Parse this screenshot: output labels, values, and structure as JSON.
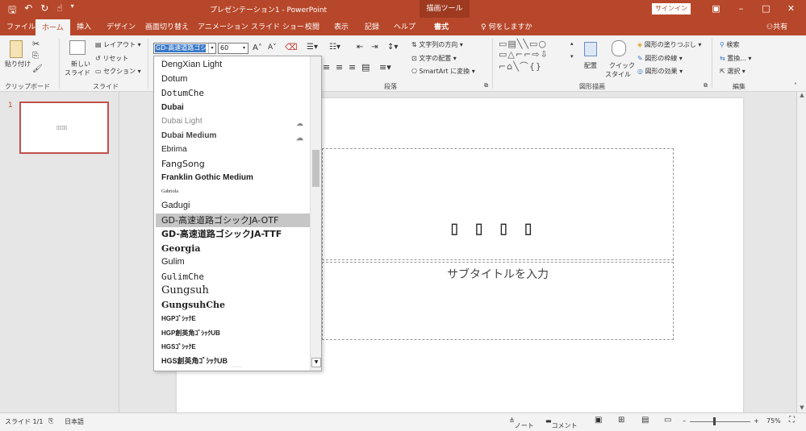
{
  "app": {
    "title": "プレゼンテーション1 - PowerPoint",
    "context_tool": "描画ツール",
    "signin": "サインイン",
    "quick_access": [
      "save-icon",
      "undo-icon",
      "redo-icon",
      "touch-icon",
      "customize-icon"
    ]
  },
  "tabs": [
    "ファイル",
    "ホーム",
    "挿入",
    "デザイン",
    "画面切り替え",
    "アニメーション",
    "スライド ショー",
    "校閲",
    "表示",
    "記録",
    "ヘルプ",
    "書式"
  ],
  "active_tab": "ホーム",
  "tell_me": "何をしますか",
  "share": "共有",
  "ribbon": {
    "clipboard": {
      "paste": "貼り付け",
      "label": "クリップボード"
    },
    "slides": {
      "new_slide_1": "新しい",
      "new_slide_2": "スライド",
      "layout": "レイアウト",
      "reset": "リセット",
      "section": "セクション",
      "label": "スライド"
    },
    "font": {
      "name_value": "GD-高速道路ゴシ",
      "size_value": "60"
    },
    "paragraph": {
      "text_direction": "文字列の方向",
      "align_text": "文字の配置",
      "smartart": "SmartArt に変換",
      "label": "段落"
    },
    "drawing": {
      "arrange": "配置",
      "quick_styles_1": "クイック",
      "quick_styles_2": "スタイル",
      "shape_fill": "図形の塗りつぶし",
      "shape_outline": "図形の枠線",
      "shape_effects": "図形の効果",
      "label": "図形描画"
    },
    "editing": {
      "find": "検索",
      "replace": "置換...",
      "select": "選択",
      "label": "編集"
    }
  },
  "thumbnail": {
    "number": "1",
    "preview": "▯▯▯▯"
  },
  "slide": {
    "title_text": "▯▯▯▯",
    "subtitle_text": "サブタイトルを入力"
  },
  "font_list": [
    {
      "name": "DengXian Light",
      "family": "Liberation Sans",
      "weight": "normal",
      "size": 11,
      "color": "#222"
    },
    {
      "name": "Dotum",
      "family": "Liberation Sans",
      "weight": "normal",
      "size": 11,
      "color": "#222"
    },
    {
      "name": "DotumChe",
      "family": "DejaVu Sans Mono",
      "weight": "normal",
      "size": 11,
      "color": "#222"
    },
    {
      "name": "Dubai",
      "family": "Liberation Sans",
      "weight": "bold",
      "size": 10,
      "color": "#222"
    },
    {
      "name": "Dubai Light",
      "family": "Liberation Sans",
      "weight": "normal",
      "size": 10,
      "color": "#888",
      "cloud": true
    },
    {
      "name": "Dubai Medium",
      "family": "Liberation Sans",
      "weight": "bold",
      "size": 10,
      "color": "#444",
      "cloud": true
    },
    {
      "name": "Ebrima",
      "family": "Liberation Sans",
      "weight": "normal",
      "size": 10,
      "color": "#222"
    },
    {
      "name": "FangSong",
      "family": "DejaVu Sans",
      "weight": "normal",
      "size": 11,
      "color": "#222"
    },
    {
      "name": "Franklin Gothic Medium",
      "family": "Liberation Sans",
      "weight": "bold",
      "size": 10,
      "color": "#222"
    },
    {
      "name": "Gabriola",
      "family": "Liberation Serif",
      "weight": "normal",
      "size": 6,
      "color": "#222"
    },
    {
      "name": "Gadugi",
      "family": "Liberation Sans",
      "weight": "normal",
      "size": 11,
      "color": "#222"
    },
    {
      "name": "GD-高速道路ゴシックJA-OTF",
      "family": "DejaVu Sans",
      "weight": "normal",
      "size": 11,
      "color": "#222"
    },
    {
      "name": "GD-高速道路ゴシックJA-TTF",
      "family": "DejaVu Sans",
      "weight": "bold",
      "size": 11,
      "color": "#222"
    },
    {
      "name": "Georgia",
      "family": "DejaVu Serif",
      "weight": "bold",
      "size": 11,
      "color": "#222"
    },
    {
      "name": "Gulim",
      "family": "Liberation Sans",
      "weight": "normal",
      "size": 11,
      "color": "#222"
    },
    {
      "name": "GulimChe",
      "family": "DejaVu Sans Mono",
      "weight": "normal",
      "size": 11,
      "color": "#222"
    },
    {
      "name": "Gungsuh",
      "family": "DejaVu Serif",
      "weight": "normal",
      "size": 13,
      "color": "#222"
    },
    {
      "name": "GungsuhChe",
      "family": "DejaVu Serif",
      "weight": "bold",
      "size": 11,
      "color": "#222"
    },
    {
      "name": "HGPｺﾞｼｯｸE",
      "family": "Liberation Sans",
      "weight": "bold",
      "size": 8,
      "color": "#222"
    },
    {
      "name": "HGP創英角ｺﾞｼｯｸUB",
      "family": "Liberation Sans",
      "weight": "bold",
      "size": 8,
      "color": "#222"
    },
    {
      "name": "HGSｺﾞｼｯｸE",
      "family": "Liberation Sans",
      "weight": "bold",
      "size": 8,
      "color": "#222"
    },
    {
      "name": "HGS創英角ｺﾞｼｯｸUB",
      "family": "Liberation Sans",
      "weight": "bold",
      "size": 9,
      "color": "#222"
    }
  ],
  "highlighted_font": "GD-高速道路ゴシックJA-OTF",
  "status": {
    "slide_of": "スライド 1/1",
    "language": "日本語",
    "notes": "ノート",
    "comments": "コメント",
    "zoom": "75%"
  },
  "colors": {
    "accent": "#b7472a",
    "selection": "#3a78c8",
    "highlight_row": "#c6c6c6"
  }
}
